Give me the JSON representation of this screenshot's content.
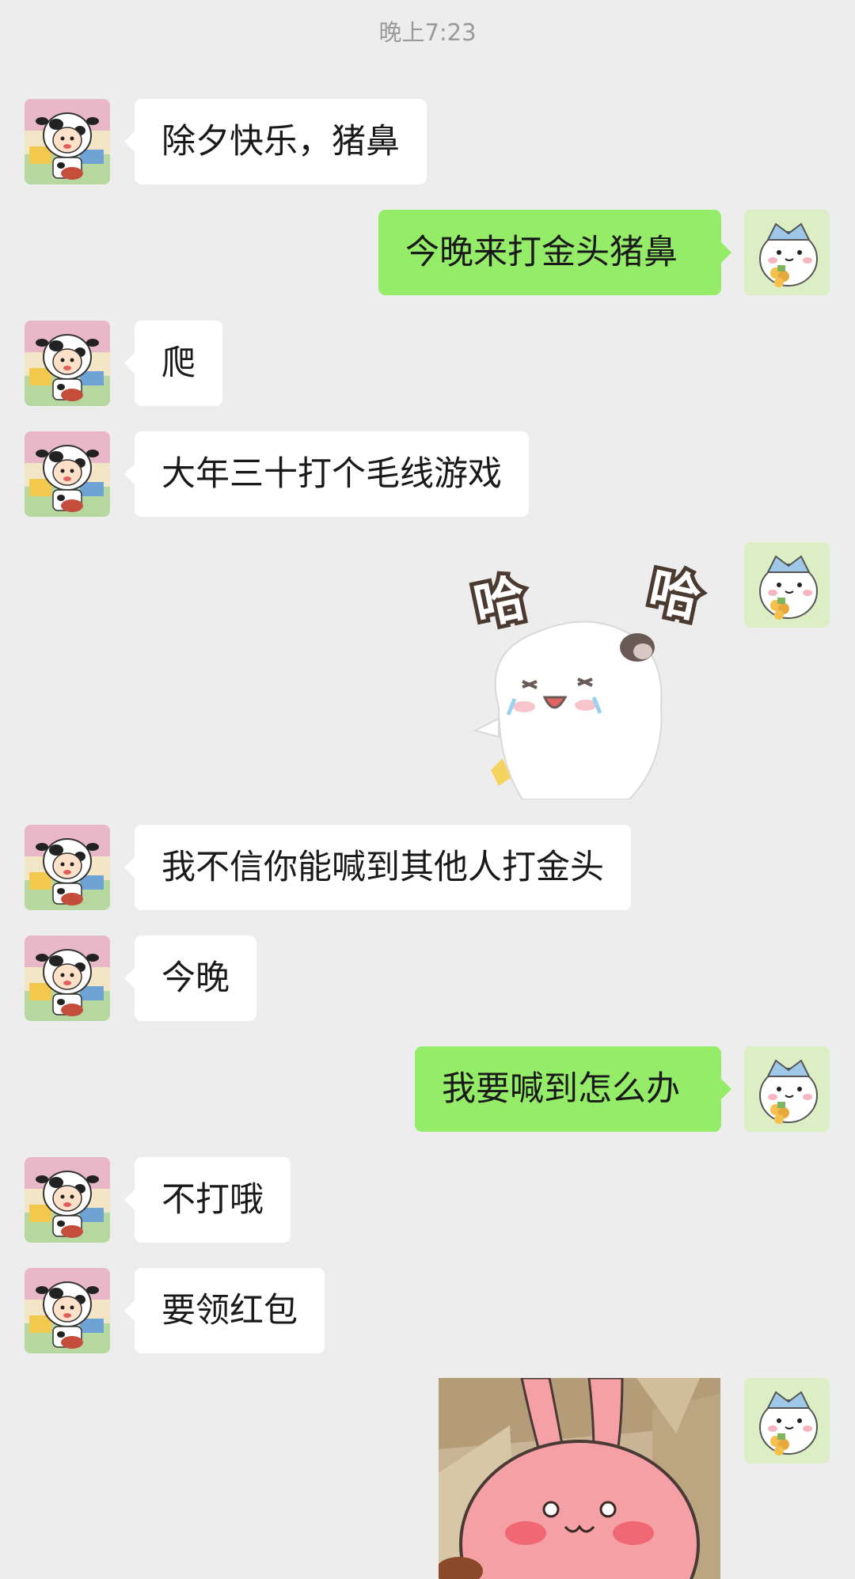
{
  "timestamp": "晚上7:23",
  "messages": [
    {
      "side": "left",
      "text": "除夕快乐，猪鼻"
    },
    {
      "side": "right",
      "text": "今晚来打金头猪鼻"
    },
    {
      "side": "left",
      "text": "爬"
    },
    {
      "side": "left",
      "text": "大年三十打个毛线游戏"
    },
    {
      "side": "right",
      "type": "sticker",
      "caption": "哈哈"
    },
    {
      "side": "left",
      "text": "我不信你能喊到其他人打金头"
    },
    {
      "side": "left",
      "text": "今晚"
    },
    {
      "side": "right",
      "text": "我要喊到怎么办"
    },
    {
      "side": "left",
      "text": "不打哦"
    },
    {
      "side": "left",
      "text": "要领红包"
    },
    {
      "side": "right",
      "type": "image"
    }
  ],
  "sticker": {
    "glyph_left": "哈",
    "glyph_right": "哈"
  },
  "colors": {
    "background": "#ededed",
    "bubble_self": "#95ec69",
    "bubble_other": "#ffffff",
    "text": "#191919",
    "timestamp": "#9a9a9a"
  },
  "icons": {
    "contact_avatar": "cow-costume-child-avatar",
    "self_avatar": "white-cat-avatar",
    "sticker": "laughing-hamster-sticker",
    "photo": "pink-bunny-cartoon"
  }
}
